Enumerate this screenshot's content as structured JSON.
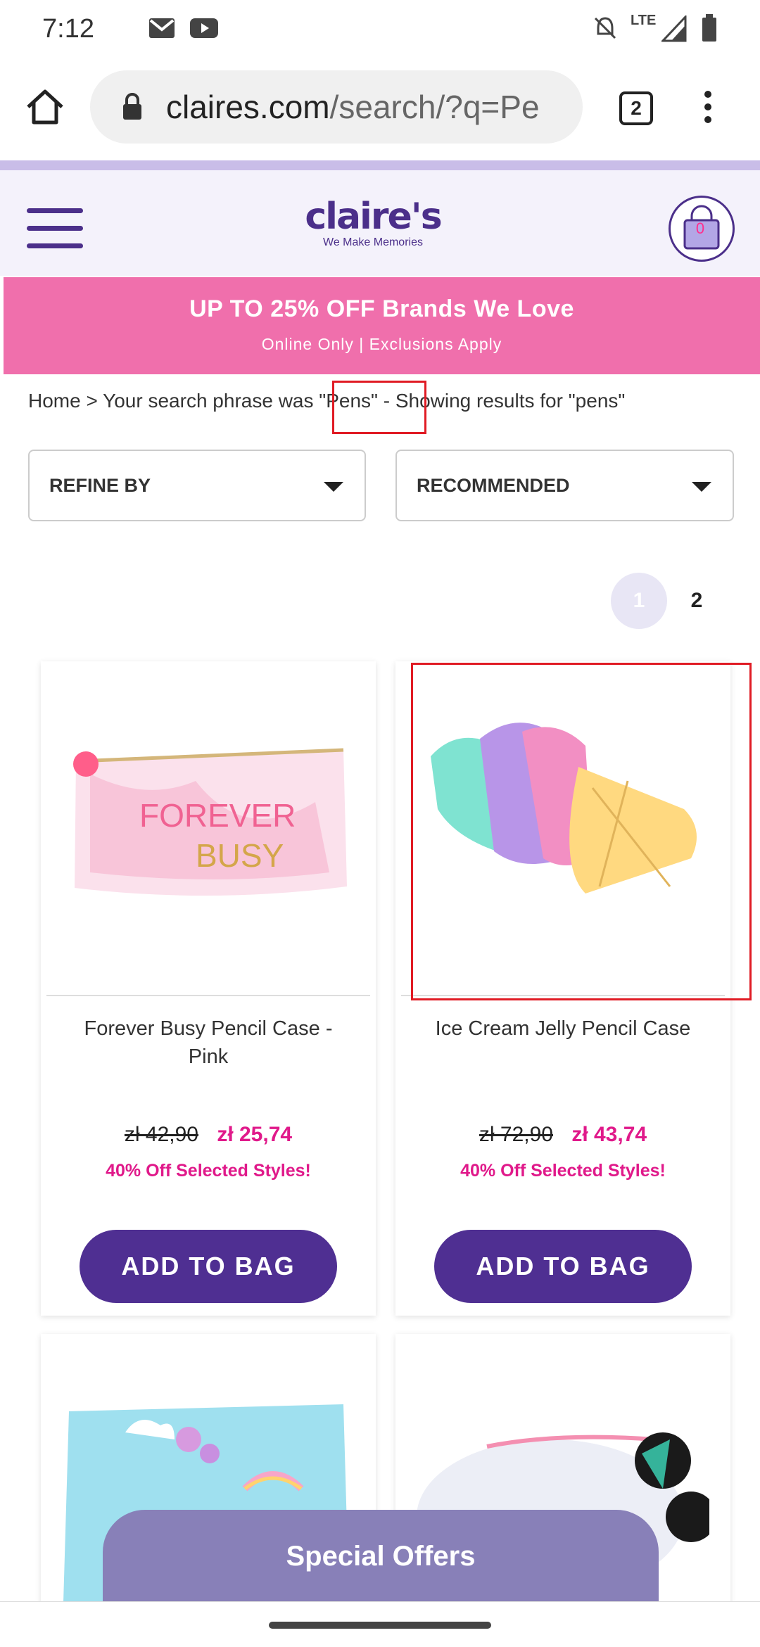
{
  "status_bar": {
    "time": "7:12",
    "network": "LTE"
  },
  "browser": {
    "url_domain": "claires.com",
    "url_path": "/search/?q=Pe",
    "tab_count": "2"
  },
  "header": {
    "logo_name": "claire's",
    "logo_tagline": "We Make Memories",
    "bag_count": "0"
  },
  "promo": {
    "title": "UP TO 25% OFF Brands We Love",
    "subtitle": "Online Only | Exclusions Apply"
  },
  "breadcrumb": {
    "home": "Home",
    "separator": ">",
    "text": "Your search phrase was \"Pens\" - Showing results for \"pens\""
  },
  "filters": {
    "refine_label": "REFINE BY",
    "sort_label": "RECOMMENDED"
  },
  "pagination": {
    "page1": "1",
    "page2": "2"
  },
  "products": [
    {
      "name": "Forever Busy Pencil Case - Pink",
      "old_price": "zł 42,90",
      "new_price": "zł 25,74",
      "offer": "40% Off Selected Styles!",
      "button": "ADD TO BAG",
      "image_text_1": "FOREVER",
      "image_text_2": "BUSY"
    },
    {
      "name": "Ice Cream Jelly Pencil Case",
      "old_price": "zł 72,90",
      "new_price": "zł 43,74",
      "offer": "40% Off Selected Styles!",
      "button": "ADD TO BAG"
    }
  ],
  "special_offers": "Special Offers",
  "colors": {
    "brand_purple": "#4f2f92",
    "promo_pink": "#f06fac",
    "price_pink": "#e0198a",
    "highlight_red": "#e01b24"
  }
}
